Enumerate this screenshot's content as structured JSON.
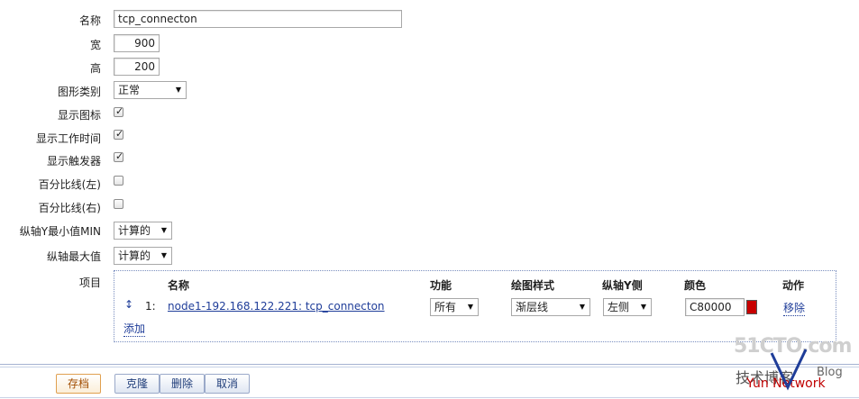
{
  "form": {
    "name": {
      "label": "名称",
      "value": "tcp_connecton"
    },
    "width": {
      "label": "宽",
      "value": "900"
    },
    "height": {
      "label": "高",
      "value": "200"
    },
    "graph_type": {
      "label": "图形类别",
      "value": "正常"
    },
    "show_legend": {
      "label": "显示图标",
      "checked": true
    },
    "show_working_time": {
      "label": "显示工作时间",
      "checked": true
    },
    "show_triggers": {
      "label": "显示触发器",
      "checked": true
    },
    "percentile_left": {
      "label": "百分比线(左)",
      "checked": false
    },
    "percentile_right": {
      "label": "百分比线(右)",
      "checked": false
    },
    "y_min": {
      "label": "纵轴Y最小值MIN",
      "value": "计算的"
    },
    "y_max": {
      "label": "纵轴最大值",
      "value": "计算的"
    }
  },
  "items": {
    "label": "项目",
    "headers": {
      "name": "名称",
      "function": "功能",
      "draw_style": "绘图样式",
      "y_axis_side": "纵轴Y侧",
      "color": "颜色",
      "action": "动作"
    },
    "rows": [
      {
        "index": "1:",
        "name": "node1-192.168.122.221: tcp_connecton",
        "function": "所有",
        "draw_style": "渐层线",
        "y_axis_side": "左侧",
        "color": "C80000",
        "color_hex": "#c80000",
        "action": "移除"
      }
    ],
    "add_label": "添加"
  },
  "buttons": {
    "save": "存档",
    "clone": "克隆",
    "delete": "删除",
    "cancel": "取消"
  },
  "watermark": {
    "line1": "51CTO.com",
    "line2": "技术博客",
    "line3": "Blog",
    "line4": "Yun Network"
  }
}
